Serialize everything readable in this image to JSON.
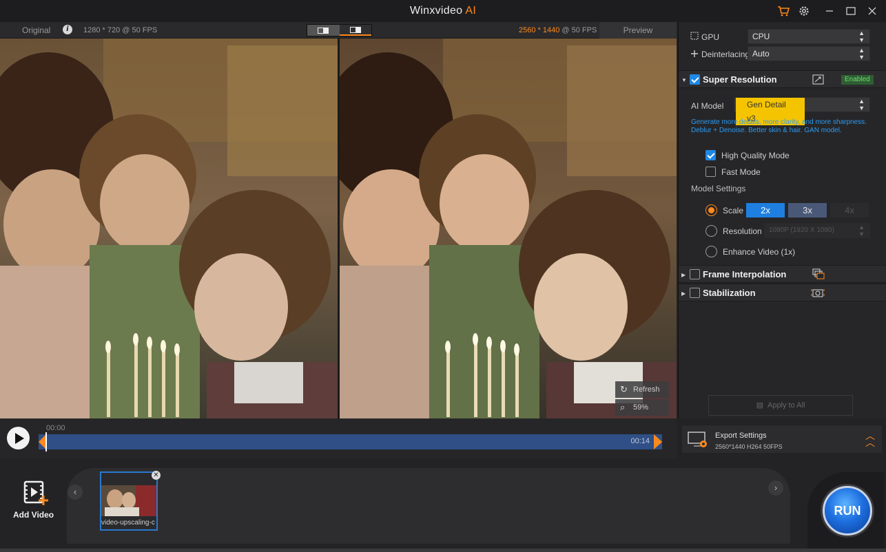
{
  "titlebar": {
    "app_name": "Winxvideo",
    "app_suffix": "AI",
    "icons": [
      "cart-icon",
      "gear-icon",
      "minimize-icon",
      "maximize-icon",
      "close-icon"
    ]
  },
  "preview_header": {
    "original_label": "Original",
    "original_info": "1280 * 720 @ 50 FPS",
    "output_res": "2560 * 1440",
    "output_fps": " @ 50 FPS",
    "preview_tab": "Preview"
  },
  "overlay": {
    "refresh_label": "Refresh",
    "zoom_label": "59%"
  },
  "timeline": {
    "start_time": "00:00",
    "end_time": "00:14"
  },
  "panel": {
    "gpu_label": "GPU",
    "gpu_value": "CPU",
    "deinterlacing_label": "Deinterlacing",
    "deinterlacing_value": "Auto",
    "super_resolution": {
      "title": "Super Resolution",
      "badge": "Enabled",
      "ai_model_label": "AI Model",
      "ai_model_value": "Gen Detail v3",
      "description": "Generate more details, more clarity, and more sharpness. Deblur + Denoise. Better skin & hair. GAN model.",
      "high_quality_label": "High Quality Mode",
      "fast_mode_label": "Fast Mode",
      "model_settings_label": "Model Settings",
      "scale_label": "Scale",
      "scale_options": [
        "2x",
        "3x",
        "4x"
      ],
      "resolution_label": "Resolution",
      "resolution_value": "1080P (1920 X 1080)",
      "enhance_label": "Enhance Video (1x)"
    },
    "frame_interpolation": {
      "title": "Frame Interpolation"
    },
    "stabilization": {
      "title": "Stabilization"
    },
    "apply_all": "Apply to All"
  },
  "export": {
    "title": "Export Settings",
    "details": "2560*1440   H264   50FPS"
  },
  "bottom": {
    "add_video_label": "Add Video",
    "thumb_name": "video-upscaling-c",
    "run_label": "RUN"
  },
  "colors": {
    "accent": "#ff8a1c",
    "blue": "#1e88e5",
    "highlight_yellow": "#f5c400"
  }
}
